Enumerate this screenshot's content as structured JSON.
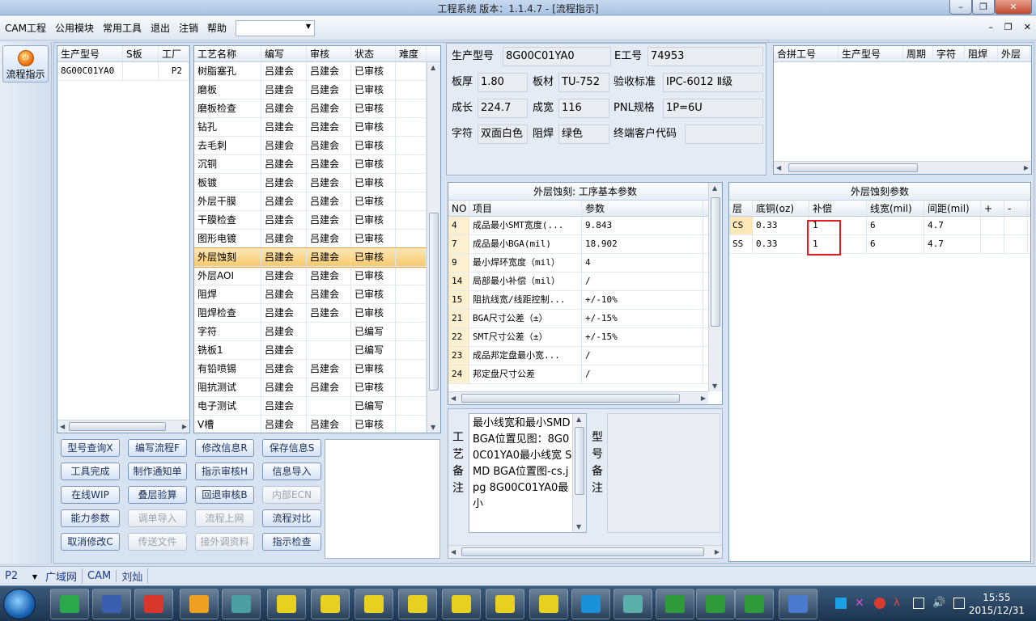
{
  "window": {
    "title": "工程系统    版本：1.1.4.7 - [流程指示]"
  },
  "menu": {
    "items": [
      "CAM工程",
      "公用模块",
      "常用工具",
      "退出",
      "注销",
      "帮助"
    ],
    "combo_value": ""
  },
  "rail": {
    "flow_label": "流程指示"
  },
  "order_list": {
    "columns": [
      "生产型号",
      "S板",
      "工厂"
    ],
    "rows": [
      {
        "model": "8G00C01YA0",
        "s": "",
        "factory": "P2"
      }
    ]
  },
  "process_list": {
    "columns": [
      "工艺名称",
      "编写",
      "审核",
      "状态",
      "难度"
    ],
    "rows": [
      [
        "树脂塞孔",
        "吕建会",
        "吕建会",
        "已审核",
        ""
      ],
      [
        "磨板",
        "吕建会",
        "吕建会",
        "已审核",
        ""
      ],
      [
        "磨板检查",
        "吕建会",
        "吕建会",
        "已审核",
        ""
      ],
      [
        "钻孔",
        "吕建会",
        "吕建会",
        "已审核",
        ""
      ],
      [
        "去毛刺",
        "吕建会",
        "吕建会",
        "已审核",
        ""
      ],
      [
        "沉铜",
        "吕建会",
        "吕建会",
        "已审核",
        ""
      ],
      [
        "板镀",
        "吕建会",
        "吕建会",
        "已审核",
        ""
      ],
      [
        "外层干膜",
        "吕建会",
        "吕建会",
        "已审核",
        ""
      ],
      [
        "干膜检查",
        "吕建会",
        "吕建会",
        "已审核",
        ""
      ],
      [
        "图形电镀",
        "吕建会",
        "吕建会",
        "已审核",
        ""
      ],
      [
        "外层蚀刻",
        "吕建会",
        "吕建会",
        "已审核",
        ""
      ],
      [
        "外层AOI",
        "吕建会",
        "吕建会",
        "已审核",
        ""
      ],
      [
        "阻焊",
        "吕建会",
        "吕建会",
        "已审核",
        ""
      ],
      [
        "阻焊检查",
        "吕建会",
        "吕建会",
        "已审核",
        ""
      ],
      [
        "字符",
        "吕建会",
        "",
        "已编写",
        ""
      ],
      [
        "铣板1",
        "吕建会",
        "",
        "已编写",
        ""
      ],
      [
        "有铅喷锡",
        "吕建会",
        "吕建会",
        "已审核",
        ""
      ],
      [
        "阻抗测试",
        "吕建会",
        "吕建会",
        "已审核",
        ""
      ],
      [
        "电子测试",
        "吕建会",
        "",
        "已编写",
        ""
      ],
      [
        "V槽",
        "吕建会",
        "吕建会",
        "已审核",
        ""
      ]
    ],
    "selected_index": 10
  },
  "buttons": [
    [
      "型号查询X",
      "编写流程F",
      "修改信息R",
      "保存信息S"
    ],
    [
      "工具完成",
      "制作通知单",
      "指示审核H",
      "信息导入"
    ],
    [
      "在线WIP",
      "叠层验算",
      "回退审核B",
      "内部ECN"
    ],
    [
      "能力参数",
      "调单导入",
      "流程上网",
      "流程对比"
    ],
    [
      "取消修改C",
      "传送文件",
      "接外调资料",
      "指示检查"
    ]
  ],
  "disabled_buttons": [
    "内部ECN",
    "调单导入",
    "流程上网",
    "传送文件",
    "接外调资料"
  ],
  "info": {
    "model_label": "生产型号",
    "model": "8G00C01YA0",
    "eno_label": "E工号",
    "eno": "74953",
    "thick_label": "板厚",
    "thick": "1.80",
    "material_label": "板材",
    "material": "TU-752",
    "std_label": "验收标准",
    "std": "IPC-6012 Ⅱ级",
    "len_label": "成长",
    "len": "224.7",
    "wid_label": "成宽",
    "wid": "116",
    "pnl_label": "PNL规格",
    "pnl": "1P=6U",
    "char_label": "字符",
    "char": "双面白色",
    "mask_label": "阻焊",
    "mask": "绿色",
    "customer_label": "终端客户代码",
    "customer": ""
  },
  "combined_list": {
    "columns": [
      "合拼工号",
      "生产型号",
      "周期",
      "字符",
      "阻焊",
      "外层"
    ]
  },
  "basic_params": {
    "caption": "外层蚀刻: 工序基本参数",
    "columns": [
      "NO",
      "项目",
      "参数"
    ],
    "rows": [
      [
        "4",
        "成品最小SMT宽度(...",
        "9.843"
      ],
      [
        "7",
        "成品最小BGA(mil)",
        "18.902"
      ],
      [
        "9",
        "最小焊环宽度（mil）",
        "4"
      ],
      [
        "14",
        "局部最小补偿（mil）",
        "/"
      ],
      [
        "15",
        "阻抗线宽/线距控制...",
        "+/-10%"
      ],
      [
        "21",
        "BGA尺寸公差（±）",
        "+/-15%"
      ],
      [
        "22",
        "SMT尺寸公差（±）",
        "+/-15%"
      ],
      [
        "23",
        "成品邦定盘最小宽...",
        "/"
      ],
      [
        "24",
        "邦定盘尺寸公差",
        "/"
      ]
    ]
  },
  "etch_params": {
    "caption": "外层蚀刻参数",
    "columns": [
      "层",
      "底铜(oz)",
      "补偿",
      "线宽(mil)",
      "间距(mil)",
      "+",
      "-"
    ],
    "rows": [
      [
        "CS",
        "0.33",
        "1",
        "6",
        "4.7",
        "",
        ""
      ],
      [
        "SS",
        "0.33",
        "1",
        "6",
        "4.7",
        "",
        ""
      ]
    ]
  },
  "notes": {
    "process_label": "工艺备注",
    "process_text": "最小线宽和最小SMD BGA位置见图：8G00C01YA0最小线宽 SMD BGA位置图-cs.jpg 8G00C01YA0最小",
    "model_label": "型号备注"
  },
  "status": {
    "factory": "P2",
    "items": [
      "广域网",
      "CAM",
      "刘灿"
    ]
  },
  "taskbar": {
    "time": "15:55",
    "date": "2015/12/31"
  }
}
